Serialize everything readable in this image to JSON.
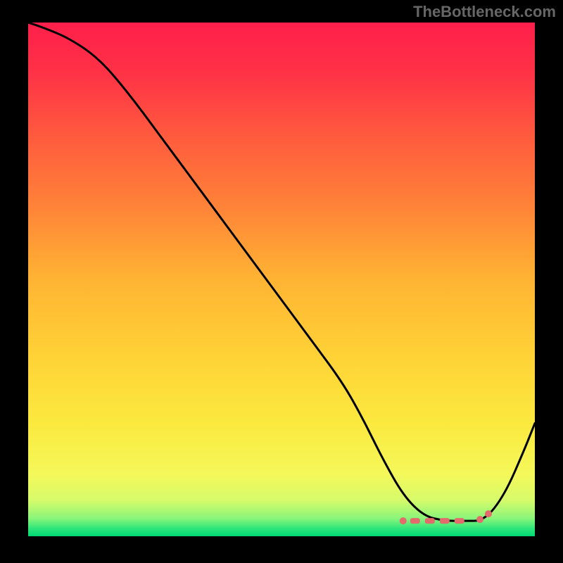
{
  "attribution": "TheBottleneck.com",
  "chart_data": {
    "type": "line",
    "title": "",
    "xlabel": "",
    "ylabel": "",
    "xlim": [
      0,
      100
    ],
    "ylim": [
      0,
      100
    ],
    "x": [
      0,
      3,
      8,
      14,
      20,
      26,
      32,
      38,
      44,
      50,
      56,
      62,
      66,
      70,
      74,
      78,
      82,
      86,
      90,
      94,
      98,
      100
    ],
    "values": [
      100,
      99,
      97,
      93,
      86,
      78,
      70,
      62,
      54,
      46,
      38,
      30,
      23,
      15,
      8,
      4,
      3,
      3,
      3,
      8,
      17,
      22
    ],
    "flat_region": {
      "x_start": 74,
      "x_end": 90,
      "y": 3
    },
    "marker_color": "#e36b6b",
    "curve_color": "#000000",
    "gradient_stops": [
      {
        "offset": 0.0,
        "color": "#ff1f4b"
      },
      {
        "offset": 0.1,
        "color": "#ff3246"
      },
      {
        "offset": 0.22,
        "color": "#ff5a3e"
      },
      {
        "offset": 0.35,
        "color": "#ff8038"
      },
      {
        "offset": 0.5,
        "color": "#ffb433"
      },
      {
        "offset": 0.65,
        "color": "#ffd236"
      },
      {
        "offset": 0.78,
        "color": "#fbe93e"
      },
      {
        "offset": 0.88,
        "color": "#f4f85a"
      },
      {
        "offset": 0.93,
        "color": "#d6fb6a"
      },
      {
        "offset": 0.965,
        "color": "#8af57a"
      },
      {
        "offset": 0.985,
        "color": "#2de67a"
      },
      {
        "offset": 1.0,
        "color": "#00d873"
      }
    ]
  }
}
